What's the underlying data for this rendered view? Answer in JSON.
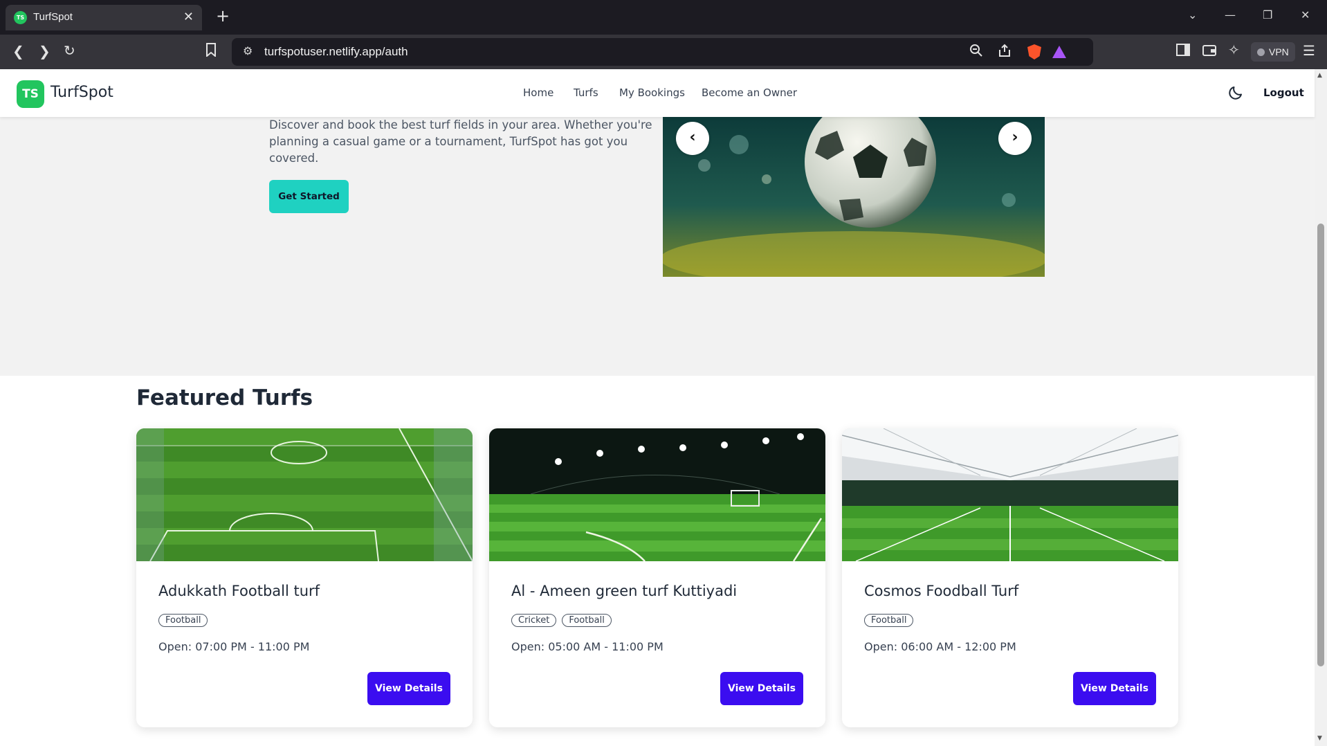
{
  "browser": {
    "tab_title": "TurfSpot",
    "tab_favicon_text": "TS",
    "url": "turfspotuser.netlify.app/auth",
    "vpn_label": "VPN"
  },
  "site": {
    "logo_badge": "TS",
    "logo_text": "TurfSpot",
    "nav": [
      "Home",
      "Turfs",
      "My Bookings",
      "Become an Owner"
    ],
    "logout_label": "Logout",
    "theme_toggle_icon": "moon-icon"
  },
  "hero": {
    "description": "Discover and book the best turf fields in your area. Whether you're planning a casual game or a tournament, TurfSpot has got you covered.",
    "cta_label": "Get Started",
    "carousel_prev": "‹",
    "carousel_next": "›"
  },
  "featured": {
    "title": "Featured Turfs",
    "cards": [
      {
        "name": "Adukkath Football turf",
        "tags": [
          "Football"
        ],
        "hours": "Open: 07:00 PM - 11:00 PM",
        "button": "View Details"
      },
      {
        "name": "Al - Ameen green turf Kuttiyadi",
        "tags": [
          "Cricket",
          "Football"
        ],
        "hours": "Open: 05:00 AM - 11:00 PM",
        "button": "View Details"
      },
      {
        "name": "Cosmos Foodball Turf",
        "tags": [
          "Football"
        ],
        "hours": "Open: 06:00 AM - 12:00 PM",
        "button": "View Details"
      }
    ]
  },
  "colors": {
    "brand_green": "#22c55e",
    "cta_teal": "#1fd1c1",
    "button_purple": "#3b0df0"
  }
}
